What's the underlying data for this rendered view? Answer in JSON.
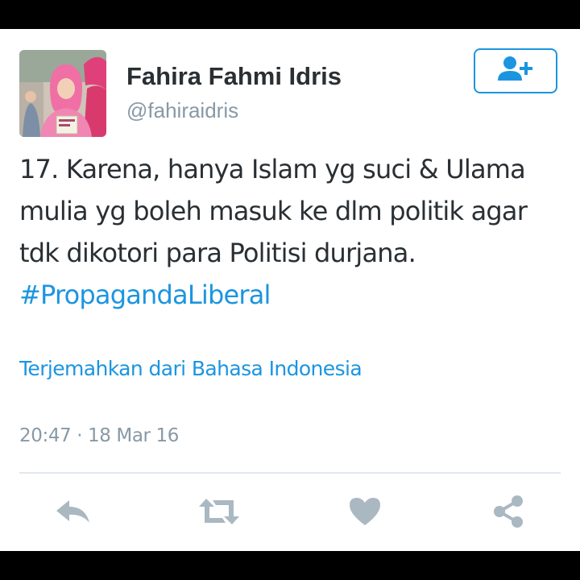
{
  "tweet": {
    "display_name": "Fahira Fahmi Idris",
    "handle": "@fahiraidris",
    "text": "17. Karena, hanya Islam yg suci & Ulama mulia yg boleh masuk ke dlm politik agar tdk dikotori para Politisi durjana.",
    "hashtag": "#PropagandaLiberal",
    "translate_link": "Terjemahkan dari Bahasa Indonesia",
    "timestamp": "20:47 · 18 Mar 16"
  },
  "icons": {
    "follow": "add-user-icon",
    "reply": "reply-icon",
    "retweet": "retweet-icon",
    "like": "heart-icon",
    "share": "share-icon"
  },
  "colors": {
    "accent": "#1b95e0",
    "text": "#292f33",
    "muted": "#8899a6",
    "action_icons": "#aab8c2"
  }
}
